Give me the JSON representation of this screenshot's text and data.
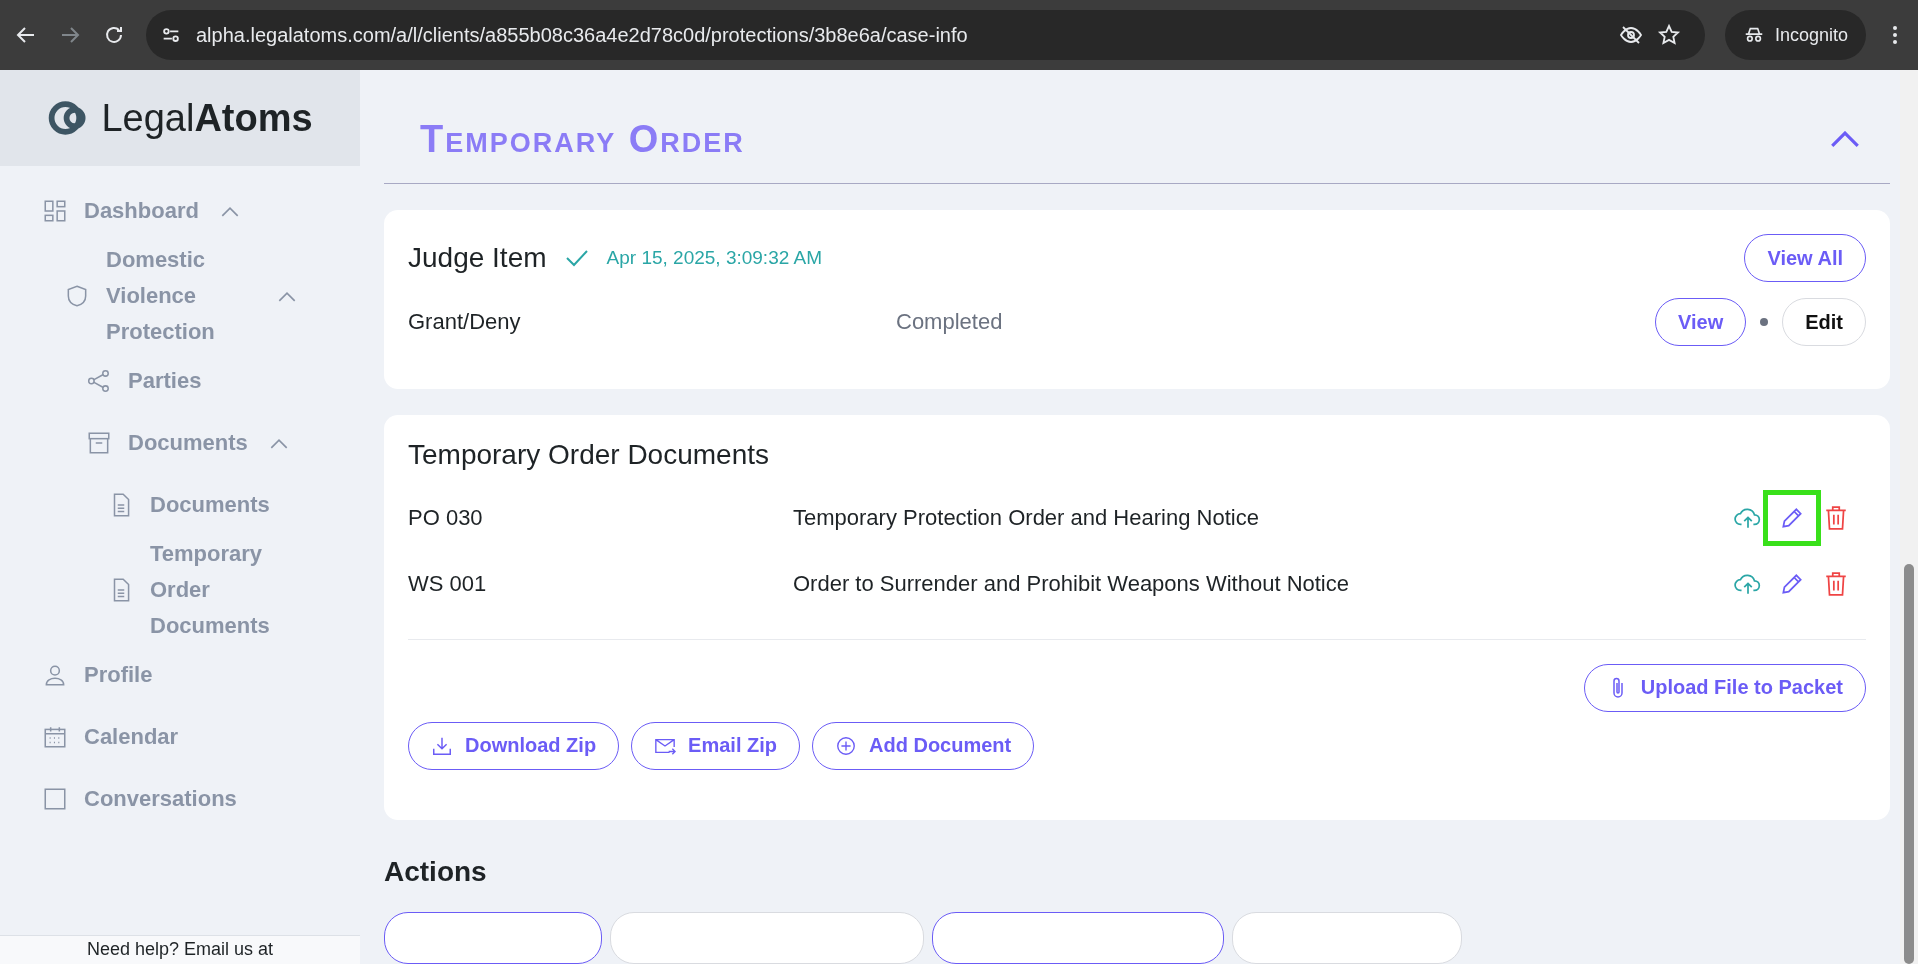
{
  "browser": {
    "url": "alpha.legalatoms.com/a/l/clients/a855b08c36a4e2d78c0d/protections/3b8e6a/case-info",
    "profile": "Incognito"
  },
  "sidebar": {
    "logo": "Legal**Atoms**",
    "items": [
      {
        "label": "Dashboard",
        "expanded": true,
        "children": [
          {
            "label": "Domestic Violence Protection",
            "expanded": true,
            "children": [
              {
                "label": "Parties"
              },
              {
                "label": "Documents",
                "expanded": true,
                "children": [
                  {
                    "label": "Documents"
                  },
                  {
                    "label": "Temporary Order Documents"
                  }
                ]
              }
            ]
          }
        ]
      },
      {
        "label": "Profile"
      },
      {
        "label": "Calendar"
      },
      {
        "label": "Conversations"
      }
    ],
    "help_text": "Need help? Email us at"
  },
  "section": {
    "title": "Temporary Order",
    "expanded": true
  },
  "judge_card": {
    "title": "Judge Item",
    "completed": true,
    "timestamp": "Apr 15, 2025, 3:09:32 AM",
    "view_all": "View All",
    "row": {
      "name": "Grant/Deny",
      "status": "Completed",
      "buttons": [
        {
          "label": "View",
          "kind": "primary"
        },
        {
          "label": "Edit",
          "kind": "plain"
        }
      ]
    }
  },
  "documents_card": {
    "title": "Temporary Order Documents",
    "rows": [
      {
        "code": "PO 030",
        "title": "Temporary Protection Order and Hearing Notice",
        "highlighted": true
      },
      {
        "code": "WS 001",
        "title": "Order to Surrender and Prohibit Weapons Without Notice",
        "highlighted": false
      }
    ],
    "upload": "Upload File to Packet",
    "buttons": [
      {
        "label": "Download Zip",
        "kind": "download"
      },
      {
        "label": "Email Zip",
        "kind": "email"
      },
      {
        "label": "Add Document",
        "kind": "add"
      }
    ]
  },
  "actions": {
    "title": "Actions",
    "buttons": [
      {
        "kind": "primary"
      },
      {
        "kind": "plain"
      },
      {
        "kind": "primary"
      },
      {
        "kind": "plain"
      }
    ]
  }
}
